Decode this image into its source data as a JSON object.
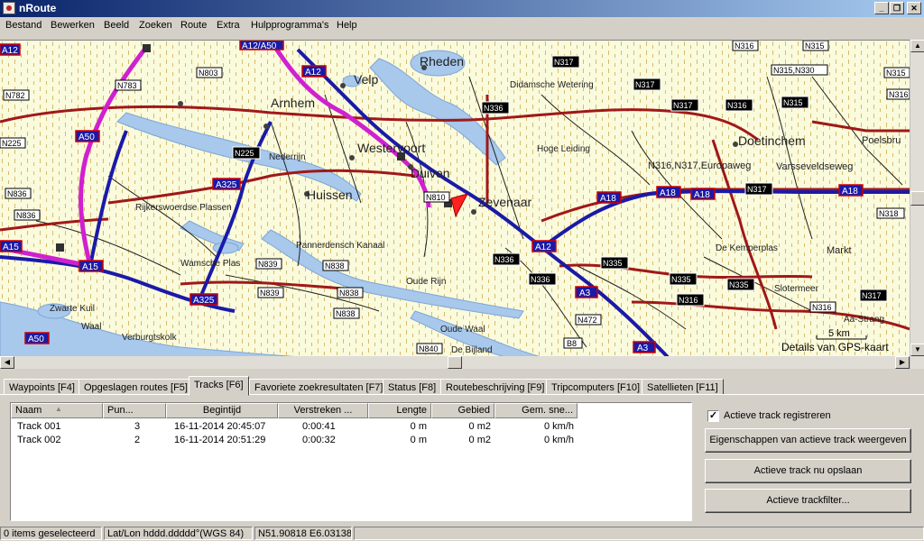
{
  "window": {
    "title": "nRoute"
  },
  "menu": [
    "Bestand",
    "Bewerken",
    "Beeld",
    "Zoeken",
    "Route",
    "Extra",
    "Hulpprogramma's",
    "Help"
  ],
  "map": {
    "places": [
      "Arnhem",
      "Velp",
      "Rheden",
      "Westervoort",
      "Duiven",
      "Huissen",
      "Zevenaar",
      "Doetinchem",
      "Nederrijn",
      "Rijkerswoerdse Plassen",
      "Pannerdensch Kanaal",
      "Oude Rijn",
      "Oude Waal",
      "De Bijland",
      "De Kemperplas",
      "Slotermeer",
      "Didamsche Wetering",
      "Hoge Leiding",
      "N316,N317,Europaweg",
      "Varsseveldseweg",
      "Poelsbru",
      "Markt",
      "Aa-Strang",
      "Zwarte Kuil",
      "Waal",
      "Verburgtskolk",
      "Wamsche Plas"
    ],
    "road_shields": [
      "A12",
      "A12",
      "A12",
      "A15",
      "A15",
      "A18",
      "A18",
      "A18",
      "A18",
      "A3",
      "A3",
      "A325",
      "A325",
      "A50",
      "A50",
      "A12/A50",
      "N316",
      "N315",
      "N315,N330",
      "N317",
      "N317",
      "N317",
      "N317",
      "N317",
      "N803",
      "N783",
      "N782",
      "N225",
      "N225",
      "N836",
      "N836",
      "N336",
      "N336",
      "N336",
      "N335",
      "N335",
      "N335",
      "N839",
      "N839",
      "N838",
      "N838",
      "N838",
      "N840",
      "N810",
      "N316",
      "N316",
      "N318",
      "N316",
      "N472",
      "B8",
      "N316",
      "N315",
      "N315"
    ],
    "scale": "5 km",
    "attribution": "Details van GPS-kaart",
    "colors": {
      "land": "#fafadc",
      "water": "#a8c8ec",
      "highway": "#1a1aa8",
      "main_road": "#a01818",
      "route": "#d020d0"
    }
  },
  "tabs": [
    "Waypoints [F4]",
    "Opgeslagen routes [F5]",
    "Tracks [F6]",
    "Favoriete zoekresultaten [F7]",
    "Status [F8]",
    "Routebeschrijving [F9]",
    "Tripcomputers [F10]",
    "Satellieten [F11]"
  ],
  "active_tab": "Tracks [F6]",
  "tracks": {
    "columns": [
      "Naam",
      "Pun...",
      "Begintijd",
      "Verstreken ...",
      "Lengte",
      "Gebied",
      "Gem. sne..."
    ],
    "rows": [
      [
        "Track 001",
        "3",
        "16-11-2014 20:45:07",
        "0:00:41",
        "0 m",
        "0 m2",
        "0 km/h"
      ],
      [
        "Track 002",
        "2",
        "16-11-2014 20:51:29",
        "0:00:32",
        "0 m",
        "0 m2",
        "0 km/h"
      ]
    ]
  },
  "side": {
    "checkbox_label": "Actieve track registreren",
    "checked": true,
    "buttons": [
      "Eigenschappen van actieve track weergeven",
      "Actieve track nu opslaan",
      "Actieve trackfilter..."
    ]
  },
  "status": [
    "0 items geselecteerd",
    "Lat/Lon hddd.ddddd°(WGS 84)",
    "N51.90818 E6.03138"
  ]
}
